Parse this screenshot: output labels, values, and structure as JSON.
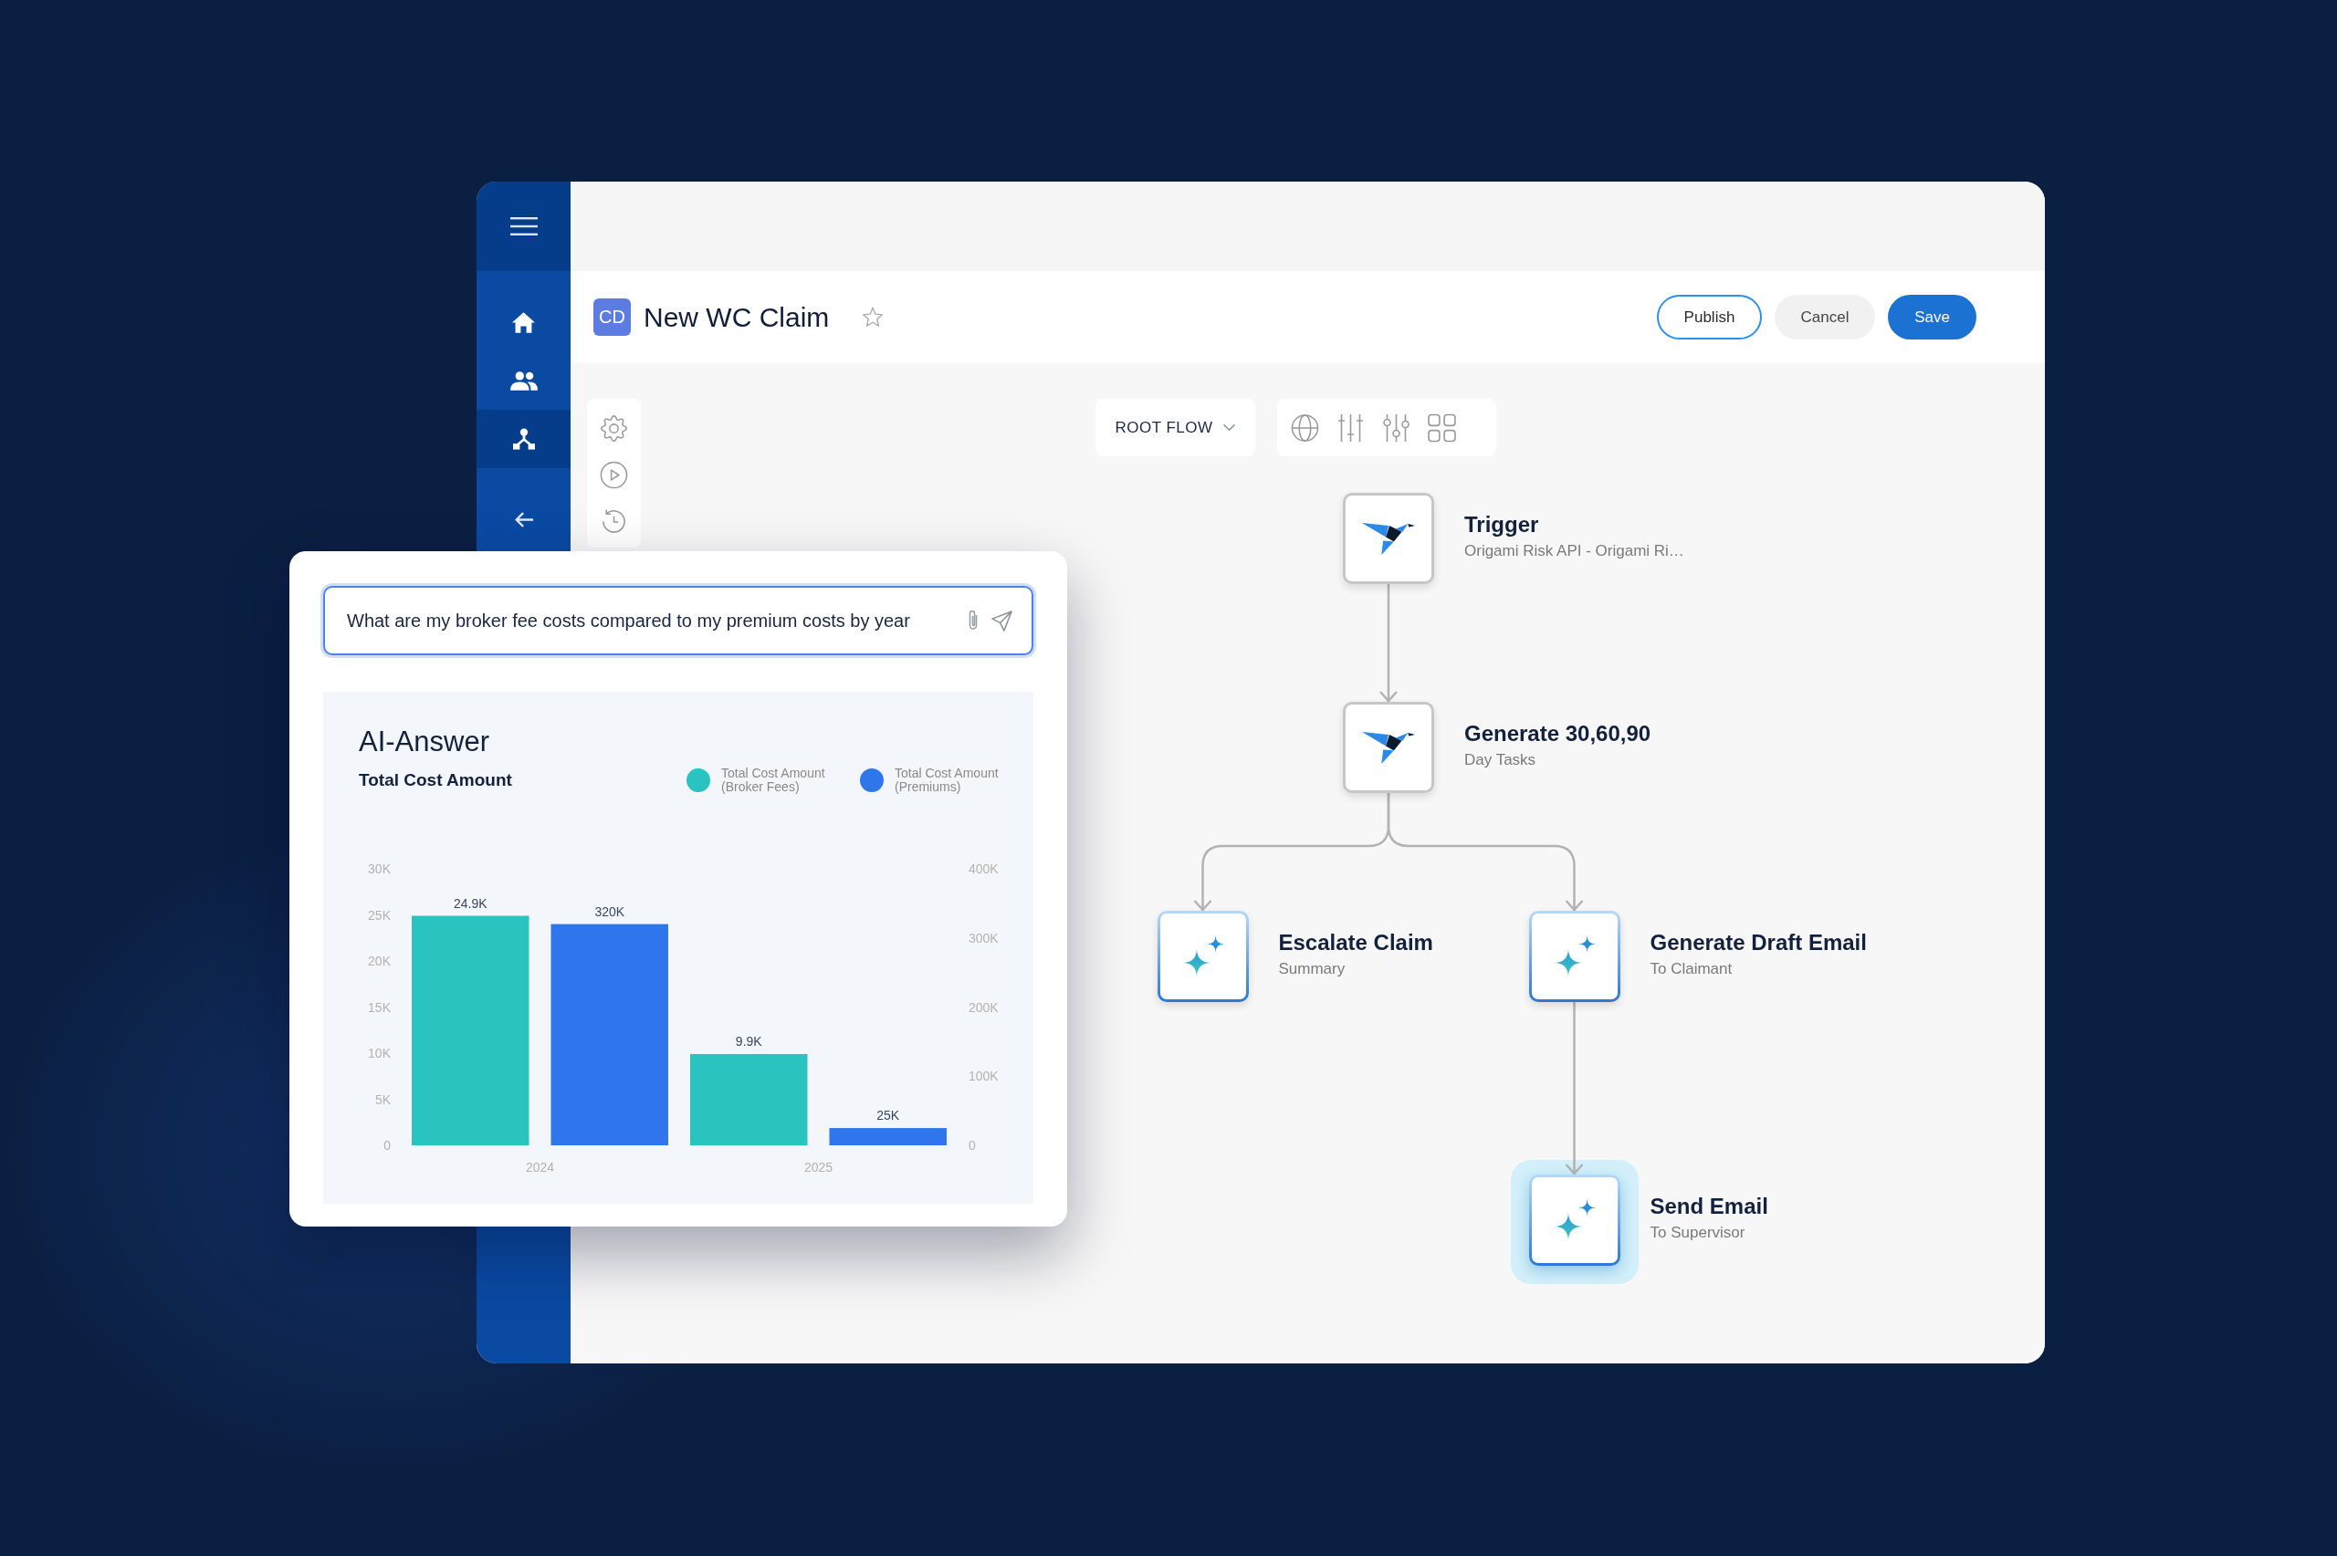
{
  "sidebar": {
    "items": [
      {
        "selected": false
      },
      {
        "selected": false
      },
      {
        "selected": true
      }
    ]
  },
  "header": {
    "badge": "CD",
    "title": "New WC Claim",
    "starred": false,
    "buttons": [
      {
        "label": "Publish",
        "kind": "outline"
      },
      {
        "label": "Cancel",
        "kind": "secondary"
      },
      {
        "label": "Save",
        "kind": "primary"
      }
    ]
  },
  "toolbar": {
    "flow_selector": "ROOT FLOW"
  },
  "flow": {
    "root": {
      "title": "Trigger",
      "subtitle": "Origami Risk API - Origami Ri…",
      "kind": "integration",
      "selected": false,
      "children": [
        {
          "title": "Generate 30,60,90",
          "subtitle": "Day Tasks",
          "kind": "integration",
          "selected": false,
          "children": [
            {
              "title": "Escalate Claim",
              "subtitle": "Summary",
              "kind": "ai",
              "selected": false
            },
            {
              "title": "Generate Draft Email",
              "subtitle": "To Claimant",
              "kind": "ai",
              "selected": false,
              "children": [
                {
                  "title": "Send Email",
                  "subtitle": "To Supervisor",
                  "kind": "ai",
                  "selected": true
                }
              ]
            }
          ]
        }
      ]
    }
  },
  "chat": {
    "query": "What are my broker fee costs compared to my premium costs by year",
    "answer": {
      "heading": "AI-Answer",
      "chart_data": {
        "type": "bar",
        "title": "Total Cost Amount",
        "legend": "top-right",
        "categories": [
          "2024",
          "2025"
        ],
        "series": [
          {
            "name": "Total Cost Amount (Broker Fees)",
            "color": "#2ac3c0",
            "values": [
              24900,
              9900
            ]
          },
          {
            "name": "Total Cost Amount (Premiums)",
            "color": "#2f76ed",
            "axis": "y2",
            "values": [
              320000,
              25000
            ]
          }
        ],
        "ylim": [
          0,
          30000
        ],
        "yticks": [
          {
            "value": 0,
            "label": "0"
          },
          {
            "value": 5000,
            "label": "5K"
          },
          {
            "value": 10000,
            "label": "10K"
          },
          {
            "value": 15000,
            "label": "15K"
          },
          {
            "value": 20000,
            "label": "20K"
          },
          {
            "value": 25000,
            "label": "25K"
          },
          {
            "value": 30000,
            "label": "30K"
          }
        ],
        "y2lim": [
          0,
          400000
        ],
        "y2ticks": [
          {
            "value": 0,
            "label": "0"
          },
          {
            "value": 100000,
            "label": "100K"
          },
          {
            "value": 200000,
            "label": "200K"
          },
          {
            "value": 300000,
            "label": "300K"
          },
          {
            "value": 400000,
            "label": "400K"
          }
        ],
        "value_labels": [
          [
            "24.9K",
            "9.9K"
          ],
          [
            "320K",
            "25K"
          ]
        ]
      }
    }
  }
}
